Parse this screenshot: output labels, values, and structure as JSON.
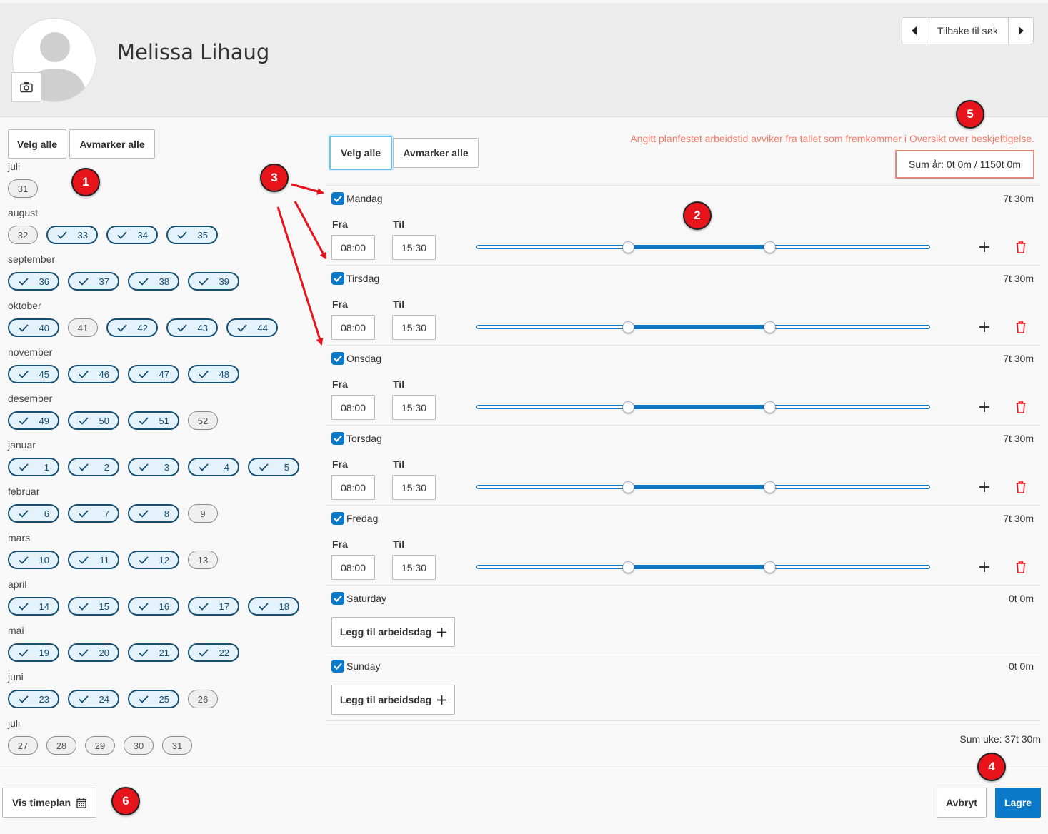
{
  "user": {
    "name": "Melissa Lihaug"
  },
  "nav": {
    "back_label": "Tilbake til søk"
  },
  "weeks_panel": {
    "select_all": "Velg alle",
    "deselect_all": "Avmarker alle",
    "months": [
      {
        "label": "juli",
        "weeks": [
          {
            "n": "31",
            "on": false
          }
        ]
      },
      {
        "label": "august",
        "weeks": [
          {
            "n": "32",
            "on": false
          },
          {
            "n": "33",
            "on": true
          },
          {
            "n": "34",
            "on": true
          },
          {
            "n": "35",
            "on": true
          }
        ]
      },
      {
        "label": "september",
        "weeks": [
          {
            "n": "36",
            "on": true
          },
          {
            "n": "37",
            "on": true
          },
          {
            "n": "38",
            "on": true
          },
          {
            "n": "39",
            "on": true
          }
        ]
      },
      {
        "label": "oktober",
        "weeks": [
          {
            "n": "40",
            "on": true
          },
          {
            "n": "41",
            "on": false
          },
          {
            "n": "42",
            "on": true
          },
          {
            "n": "43",
            "on": true
          },
          {
            "n": "44",
            "on": true
          }
        ]
      },
      {
        "label": "november",
        "weeks": [
          {
            "n": "45",
            "on": true
          },
          {
            "n": "46",
            "on": true
          },
          {
            "n": "47",
            "on": true
          },
          {
            "n": "48",
            "on": true
          }
        ]
      },
      {
        "label": "desember",
        "weeks": [
          {
            "n": "49",
            "on": true
          },
          {
            "n": "50",
            "on": true
          },
          {
            "n": "51",
            "on": true
          },
          {
            "n": "52",
            "on": false
          }
        ]
      },
      {
        "label": "januar",
        "weeks": [
          {
            "n": "1",
            "on": true
          },
          {
            "n": "2",
            "on": true
          },
          {
            "n": "3",
            "on": true
          },
          {
            "n": "4",
            "on": true
          },
          {
            "n": "5",
            "on": true
          }
        ]
      },
      {
        "label": "februar",
        "weeks": [
          {
            "n": "6",
            "on": true
          },
          {
            "n": "7",
            "on": true
          },
          {
            "n": "8",
            "on": true
          },
          {
            "n": "9",
            "on": false
          }
        ]
      },
      {
        "label": "mars",
        "weeks": [
          {
            "n": "10",
            "on": true
          },
          {
            "n": "11",
            "on": true
          },
          {
            "n": "12",
            "on": true
          },
          {
            "n": "13",
            "on": false
          }
        ]
      },
      {
        "label": "april",
        "weeks": [
          {
            "n": "14",
            "on": true
          },
          {
            "n": "15",
            "on": true
          },
          {
            "n": "16",
            "on": true
          },
          {
            "n": "17",
            "on": true
          },
          {
            "n": "18",
            "on": true
          }
        ]
      },
      {
        "label": "mai",
        "weeks": [
          {
            "n": "19",
            "on": true
          },
          {
            "n": "20",
            "on": true
          },
          {
            "n": "21",
            "on": true
          },
          {
            "n": "22",
            "on": true
          }
        ]
      },
      {
        "label": "juni",
        "weeks": [
          {
            "n": "23",
            "on": true
          },
          {
            "n": "24",
            "on": true
          },
          {
            "n": "25",
            "on": true
          },
          {
            "n": "26",
            "on": false
          }
        ]
      },
      {
        "label": "juli",
        "weeks": [
          {
            "n": "27",
            "on": false
          },
          {
            "n": "28",
            "on": false
          },
          {
            "n": "29",
            "on": false
          },
          {
            "n": "30",
            "on": false
          },
          {
            "n": "31",
            "on": false
          }
        ]
      }
    ]
  },
  "days_panel": {
    "select_all": "Velg alle",
    "deselect_all": "Avmarker alle",
    "warning": "Angitt planfestet arbeidstid avviker fra tallet som fremkommer i Oversikt over beskjeftigelse.",
    "sum_year": "Sum år: 0t 0m / 1150t 0m",
    "from_label": "Fra",
    "to_label": "Til",
    "add_day_label": "Legg til arbeidsdag",
    "slider_range": [
      0,
      24
    ],
    "days": [
      {
        "name": "Mandag",
        "total": "7t 30m",
        "checked": true,
        "from": "08:00",
        "to": "15:30",
        "from_h": 8,
        "to_h": 15.5
      },
      {
        "name": "Tirsdag",
        "total": "7t 30m",
        "checked": true,
        "from": "08:00",
        "to": "15:30",
        "from_h": 8,
        "to_h": 15.5
      },
      {
        "name": "Onsdag",
        "total": "7t 30m",
        "checked": true,
        "from": "08:00",
        "to": "15:30",
        "from_h": 8,
        "to_h": 15.5
      },
      {
        "name": "Torsdag",
        "total": "7t 30m",
        "checked": true,
        "from": "08:00",
        "to": "15:30",
        "from_h": 8,
        "to_h": 15.5
      },
      {
        "name": "Fredag",
        "total": "7t 30m",
        "checked": true,
        "from": "08:00",
        "to": "15:30",
        "from_h": 8,
        "to_h": 15.5
      },
      {
        "name": "Saturday",
        "total": "0t 0m",
        "checked": true,
        "from": null,
        "to": null
      },
      {
        "name": "Sunday",
        "total": "0t 0m",
        "checked": true,
        "from": null,
        "to": null
      }
    ],
    "sum_week": "Sum uke: 37t 30m"
  },
  "footer": {
    "schedule_label": "Vis timeplan",
    "cancel_label": "Avbryt",
    "save_label": "Lagre"
  },
  "markers": [
    "1",
    "2",
    "3",
    "4",
    "5",
    "6"
  ],
  "colors": {
    "primary": "#0b79c9",
    "chip_on_border": "#174f72",
    "warning": "#f27b6a",
    "marker": "#e8141b"
  }
}
